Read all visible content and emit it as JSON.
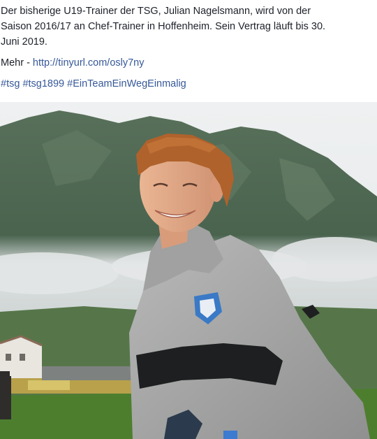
{
  "post": {
    "line1": "Der bisherige U19-Trainer der TSG, Julian Nagelsmann, wird von der",
    "line2": "Saison 2016/17 an Chef-Trainer in Hoffenheim. Sein Vertrag läuft bis 30.",
    "line3": "Juni 2019.",
    "more_prefix": "Mehr - ",
    "more_link": "http://tinyurl.com/osly7ny",
    "hashtags": [
      "#tsg",
      "#tsg1899",
      "#EinTeamEinWegEinmalig"
    ]
  },
  "photo": {
    "subject": "smiling young man with reddish hair in grey hooded jacket with club crest, mountains and clouds behind",
    "colors": {
      "sky": "#e9ecee",
      "mountain": "#4f6a55",
      "cloud": "#dfe3e4",
      "grass": "#4d7e2e",
      "jacket": "#a9aaa9",
      "hair": "#b0622c",
      "skin": "#e2aa86"
    }
  }
}
